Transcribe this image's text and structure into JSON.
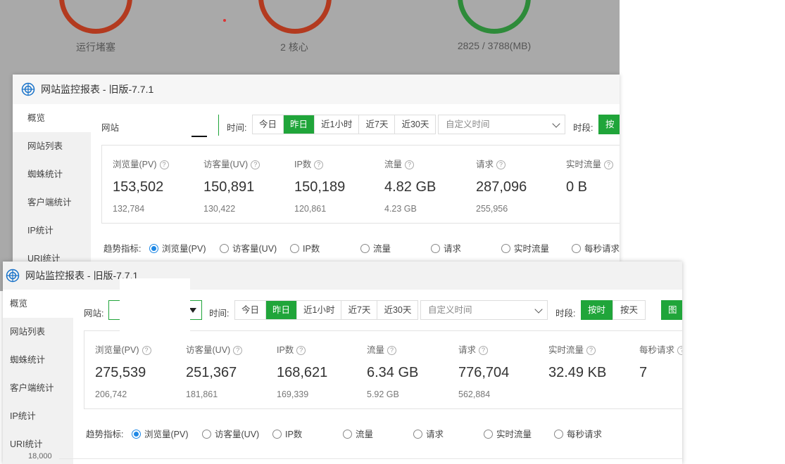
{
  "background": {
    "gauges": [
      {
        "label": "运行堵塞"
      },
      {
        "label": "2 核心"
      },
      {
        "label": "2825 / 3788(MB)"
      }
    ]
  },
  "window_front": {
    "title": "网站监控报表 - 旧版-7.7.1",
    "sidebar": [
      "概览",
      "网站列表",
      "蜘蛛统计",
      "客户端统计",
      "IP统计",
      "URI统计"
    ],
    "site_label": "网站",
    "time_label": "时间:",
    "time_options": [
      "今日",
      "昨日",
      "近1小时",
      "近7天",
      "近30天"
    ],
    "time_active": "昨日",
    "custom_time_placeholder": "自定义时间",
    "period_label": "时段:",
    "period_btn": "按时",
    "stats": [
      {
        "label": "浏览量(PV)",
        "value": "153,502",
        "prev": "132,784"
      },
      {
        "label": "访客量(UV)",
        "value": "150,891",
        "prev": "130,422"
      },
      {
        "label": "IP数",
        "value": "150,189",
        "prev": "120,861"
      },
      {
        "label": "流量",
        "value": "4.82 GB",
        "prev": "4.23 GB"
      },
      {
        "label": "请求",
        "value": "287,096",
        "prev": "255,956"
      },
      {
        "label": "实时流量",
        "value": "0 B",
        "prev": ""
      }
    ],
    "trend_label": "趋势指标:",
    "trend_options": [
      "浏览量(PV)",
      "访客量(UV)",
      "IP数",
      "流量",
      "请求",
      "实时流量",
      "每秒请求"
    ]
  },
  "window_back": {
    "title": "网站监控报表 - 旧版-7.7.1",
    "sidebar": [
      "概览",
      "网站列表",
      "蜘蛛统计",
      "客户端统计",
      "IP统计",
      "URI统计"
    ],
    "site_label": "网站:",
    "time_label": "时间:",
    "time_options": [
      "今日",
      "昨日",
      "近1小时",
      "近7天",
      "近30天"
    ],
    "time_active": "昨日",
    "custom_time_placeholder": "自定义时间",
    "period_label": "时段:",
    "period_options": [
      "按时",
      "按天"
    ],
    "chart_btn": "图表",
    "stats": [
      {
        "label": "浏览量(PV)",
        "value": "275,539",
        "prev": "206,742"
      },
      {
        "label": "访客量(UV)",
        "value": "251,367",
        "prev": "181,861"
      },
      {
        "label": "IP数",
        "value": "168,621",
        "prev": "169,339"
      },
      {
        "label": "流量",
        "value": "6.34 GB",
        "prev": "5.92 GB"
      },
      {
        "label": "请求",
        "value": "776,704",
        "prev": "562,884"
      },
      {
        "label": "实时流量",
        "value": "32.49 KB",
        "prev": ""
      },
      {
        "label": "每秒请求",
        "value": "7",
        "prev": ""
      }
    ],
    "trend_label": "趋势指标:",
    "trend_options": [
      "浏览量(PV)",
      "访客量(UV)",
      "IP数",
      "流量",
      "请求",
      "实时流量",
      "每秒请求"
    ],
    "y_axis_top": "18,000"
  }
}
